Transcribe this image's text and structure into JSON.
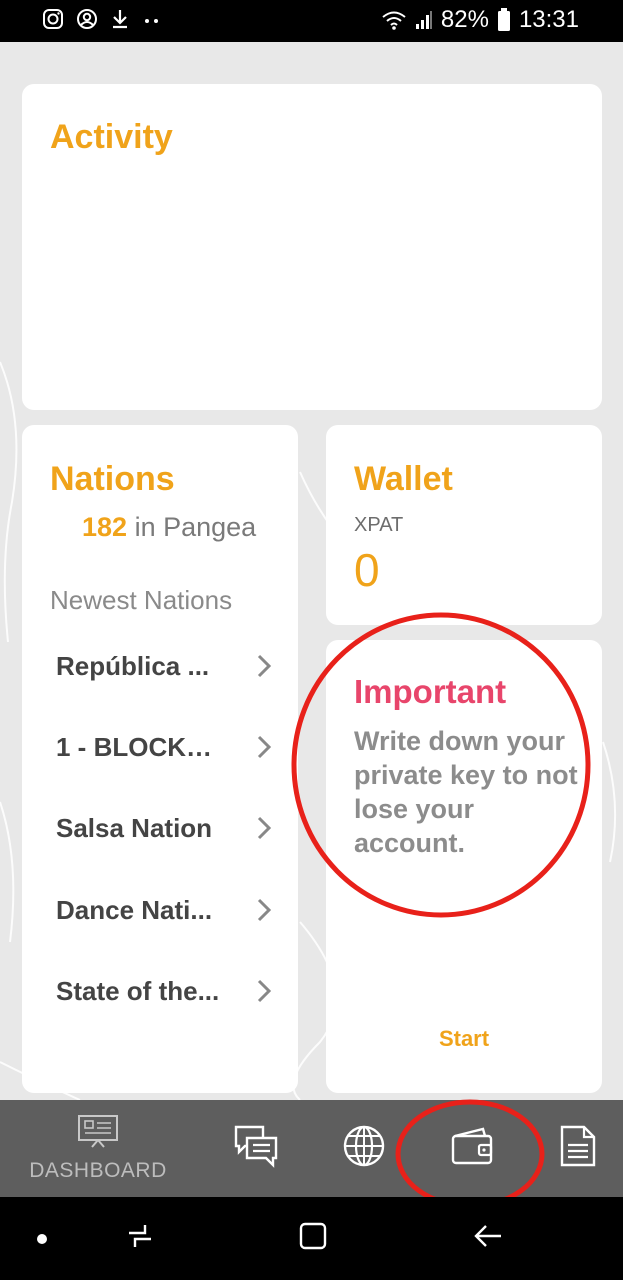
{
  "status_bar": {
    "battery": "82%",
    "time": "13:31",
    "left_icons": [
      "instagram-icon",
      "account-circle-icon",
      "download-icon",
      "more-dots-icon"
    ],
    "right_icons": [
      "wifi-icon",
      "signal-icon",
      "battery-icon"
    ]
  },
  "activity": {
    "title": "Activity"
  },
  "nations": {
    "title": "Nations",
    "count": "182",
    "count_suffix": " in Pangea",
    "newest_label": "Newest Nations",
    "items": [
      {
        "label": "República ..."
      },
      {
        "label": "1 - BLOCKC..."
      },
      {
        "label": "Salsa Nation"
      },
      {
        "label": "Dance Nati..."
      },
      {
        "label": "State of the..."
      }
    ]
  },
  "wallet": {
    "title": "Wallet",
    "currency": "XPAT",
    "balance": "0"
  },
  "important": {
    "title": "Important",
    "message": "Write down your private key to not lose your account.",
    "start_label": "Start"
  },
  "bottom_nav": {
    "dashboard_label": "DASHBOARD",
    "items": [
      "dashboard-icon",
      "chat-icon",
      "globe-icon",
      "wallet-icon",
      "document-icon"
    ]
  },
  "colors": {
    "accent": "#f0a31a",
    "important": "#e8456b",
    "annotation": "#e8211a",
    "nav_bg": "#5e5e5e"
  }
}
